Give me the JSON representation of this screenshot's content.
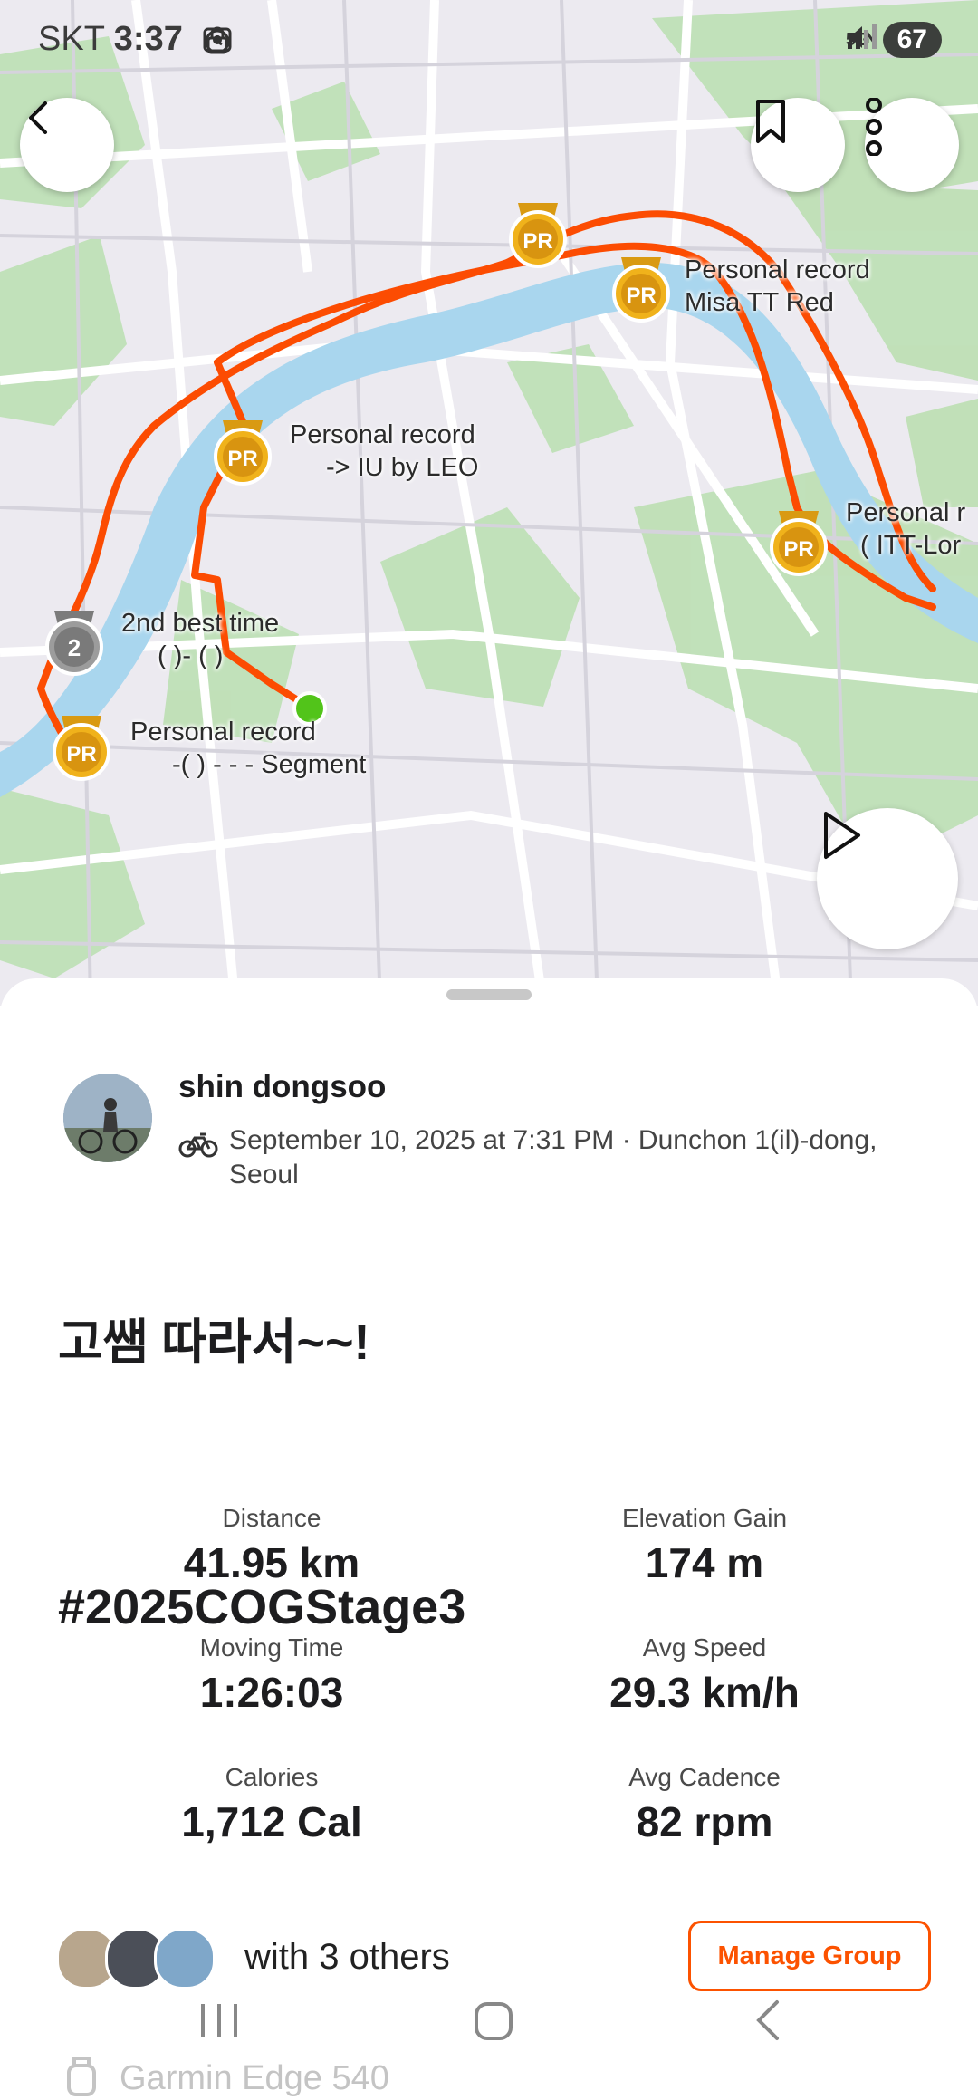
{
  "status_bar": {
    "carrier": "SKT",
    "time": "3:37",
    "network": "5G",
    "battery": "67"
  },
  "map": {
    "labels": [
      {
        "id": "pr1",
        "line1": "Personal record",
        "line2": "Misa TT Red"
      },
      {
        "id": "pr2",
        "line1": "Personal record",
        "line2": "-> IU    by LEO"
      },
      {
        "id": "pr3",
        "line1": "Personal r",
        "line2": "(   ITT-Lor"
      },
      {
        "id": "second",
        "line1": "2nd best time",
        "line2": "( )-    ( )"
      },
      {
        "id": "pr4",
        "line1": "Personal record",
        "line2": "-( )    -   -   -   Segment"
      }
    ],
    "badge_pr": "PR",
    "badge_second": "2",
    "colors": {
      "route": "#fc4c02",
      "water": "#a8d8f0",
      "park": "#b7dcae",
      "badge": "#e8a317"
    }
  },
  "activity": {
    "athlete": "shin dongsoo",
    "meta": "September 10, 2025 at 7:31 PM · Dunchon 1(il)-dong, Seoul",
    "title_line1": "고쌤 따라서~~!",
    "title_line2": "#2025COGStage3"
  },
  "stats": [
    {
      "label": "Distance",
      "value": "41.95 km"
    },
    {
      "label": "Elevation Gain",
      "value": "174 m"
    },
    {
      "label": "Moving Time",
      "value": "1:26:03"
    },
    {
      "label": "Avg Speed",
      "value": "29.3 km/h"
    },
    {
      "label": "Calories",
      "value": "1,712 Cal"
    },
    {
      "label": "Avg Cadence",
      "value": "82 rpm"
    }
  ],
  "group": {
    "with_text": "with 3 others",
    "manage_label": "Manage Group"
  },
  "device": {
    "name": "Garmin Edge 540"
  }
}
